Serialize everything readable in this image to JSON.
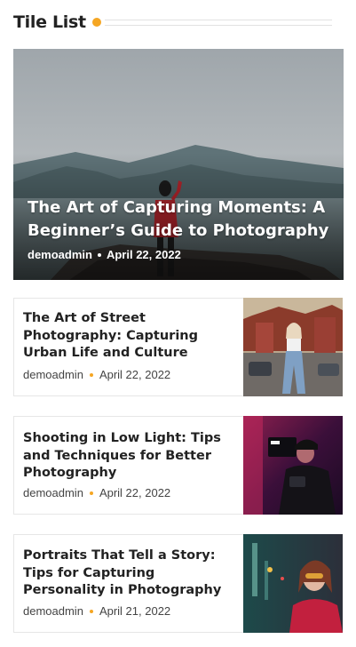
{
  "section": {
    "title": "Tile List",
    "accent": "#f5a623"
  },
  "hero": {
    "title": "The Art of Capturing Moments: A Beginner’s Guide to Photography",
    "author": "demoadmin",
    "date": "April 22, 2022"
  },
  "cards": [
    {
      "title": "The Art of Street Photography: Capturing Urban Life and Culture",
      "author": "demoadmin",
      "date": "April 22, 2022"
    },
    {
      "title": "Shooting in Low Light: Tips and Techniques for Better Photography",
      "author": "demoadmin",
      "date": "April 22, 2022"
    },
    {
      "title": "Portraits That Tell a Story: Tips for Capturing Personality in Photography",
      "author": "demoadmin",
      "date": "April 21, 2022"
    }
  ]
}
